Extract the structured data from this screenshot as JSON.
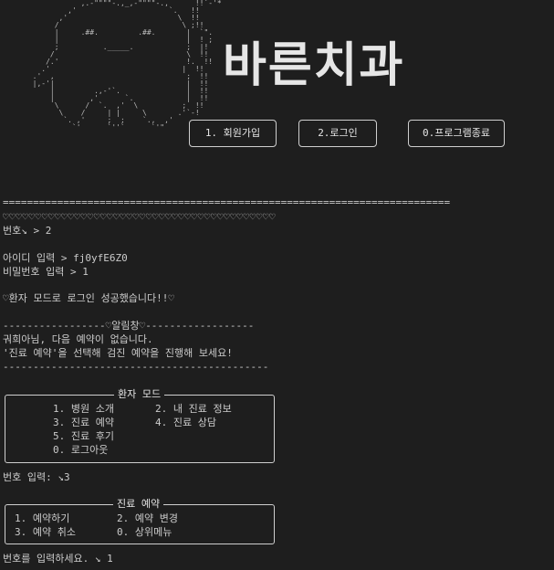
{
  "art": {
    "ascii_lines": [
      "             ,.-\"\"\"\"-.,_,-\"\"\"\"-.,      !!`-'*",
      "          ,'                     `.   !!",
      "        ,'                         \\  !!",
      "       /                            \\ ;!!",
      "       |     .##.         .##.       |  `\".",
      "       |                             |  ! ;",
      "       ;          ._____.            ;  |!",
      "      /                              \\  !!",
      "     /.'                             !.  !!",
      "    .'                              |  !!",
      "  .'  ,                              ;  !!",
      "  |,-'|                              |  !!",
      "      |         .,-'`.               |  !!",
      "      |        ,'      `.            |  !!",
      "       \\      /  `.  ,'  \\          ;  !!",
      "        \\    /     | |     \\       .'`-!",
      "         `. ,'     ;  ;    `.,  ,'",
      "           `'      `''`      `'\""
    ]
  },
  "logo": {
    "text": "바른치과"
  },
  "menu": {
    "items": [
      "1. 회원가입",
      "2.로그인",
      "0.프로그램종료"
    ]
  },
  "terminal": {
    "separator": "==========================================================================",
    "tooth_row": "♡♡♡♡♡♡♡♡♡♡♡♡♡♡♡♡♡♡♡♡♡♡♡♡♡♡♡♡♡♡♡♡♡♡♡♡♡♡♡♡♡♡",
    "number_prompt": "번호↘ > 2",
    "id_prompt": "아이디 입력 > fj0yfE6Z0",
    "pw_prompt": "비밀번호 입력 > 1",
    "login_success": "♡환자 모드로 로그인 성공했습니다!!♡",
    "notice_header": "-----------------♡알림창♡------------------",
    "notice_line1": "궈희아님, 다음 예약이 없습니다.",
    "notice_line2": "'진료 예약'을 선택해 검진 예약을 진행해 보세요!",
    "notice_footer": "--------------------------------------------",
    "patient_mode": {
      "title": "환자 모드",
      "row1_left": "1. 병원 소개",
      "row1_right": "2. 내 진료 정보",
      "row2_left": "3. 진료 예약",
      "row2_right": "4. 진료 상담",
      "row3": "5. 진료 후기",
      "row4": "0. 로그아웃"
    },
    "number_input": "번호 입력: ↘3",
    "reservation": {
      "title": "진료 예약",
      "row1_left": "1. 예약하기",
      "row1_right": "2. 예약 변경",
      "row2_left": "3. 예약 취소",
      "row2_right": "0. 상위메뉴"
    },
    "final_prompt": "번호를 입력하세요. ↘ 1"
  },
  "colors": {
    "background": "#1e1e1e",
    "text": "#cccccc",
    "border": "#cfcfcf"
  }
}
